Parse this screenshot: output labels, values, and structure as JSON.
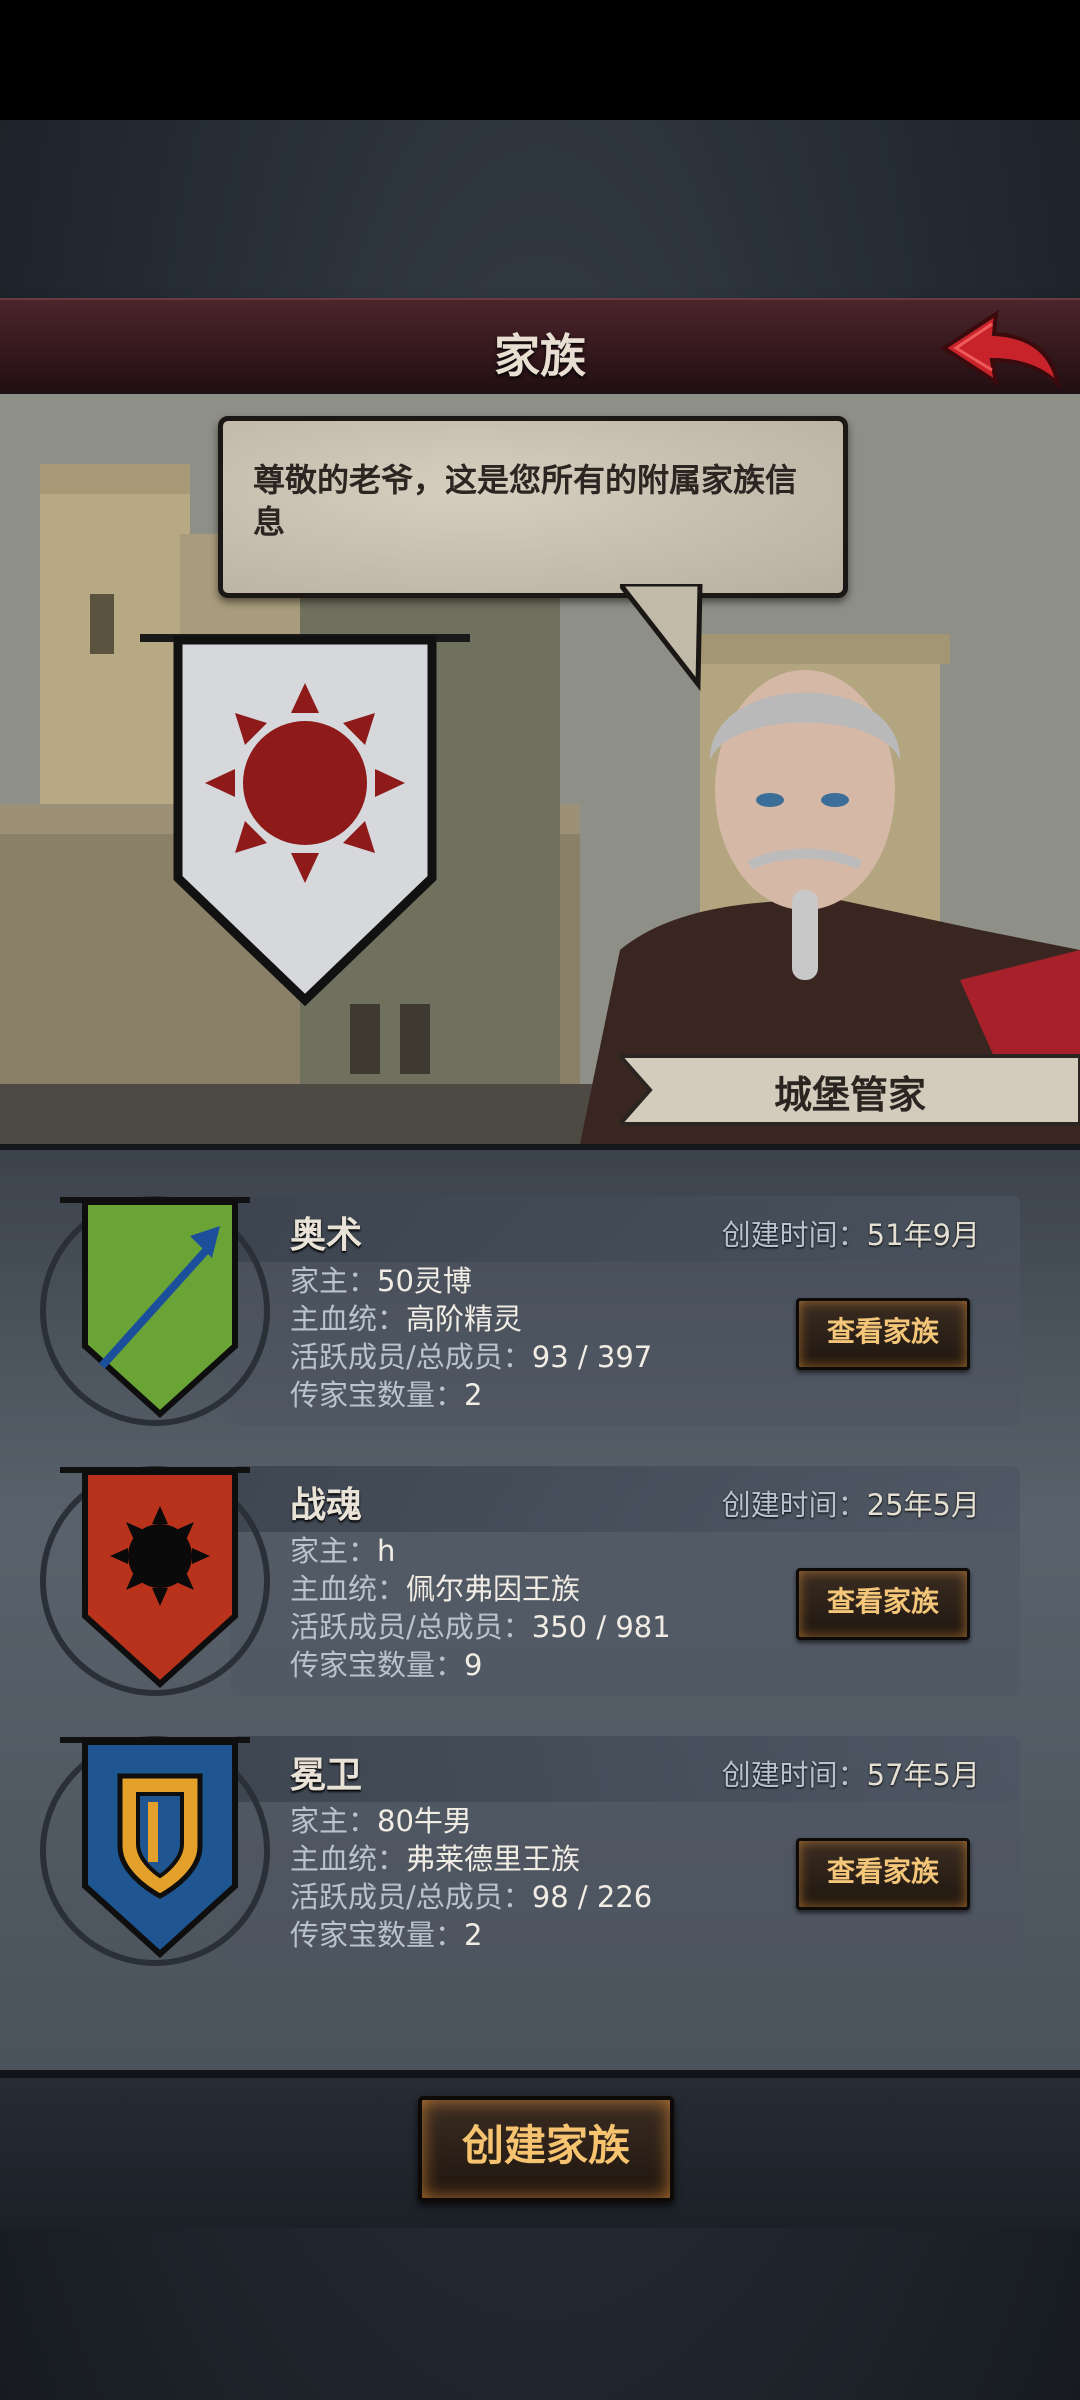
{
  "header": {
    "title": "家族"
  },
  "npc": {
    "dialog": "尊敬的老爷，这是您所有的附属家族信息",
    "name": "城堡管家"
  },
  "labels": {
    "created": "创建时间：",
    "head": "家主：",
    "bloodline": "主血统：",
    "members": "活跃成员/总成员：",
    "heirlooms": "传家宝数量："
  },
  "families": [
    {
      "name": "奥术",
      "created": "51年9月",
      "head": "50灵博",
      "bloodline": "高阶精灵",
      "members": "93 / 397",
      "heirlooms": "2",
      "button": "查看家族",
      "banner_color": "#6aa336",
      "emblem": "spear-icon"
    },
    {
      "name": "战魂",
      "created": "25年5月",
      "head": "h",
      "bloodline": "佩尔弗因王族",
      "members": "350 / 981",
      "heirlooms": "9",
      "button": "查看家族",
      "banner_color": "#b8321c",
      "emblem": "sun-icon"
    },
    {
      "name": "冕卫",
      "created": "57年5月",
      "head": "80牛男",
      "bloodline": "弗莱德里王族",
      "members": "98 / 226",
      "heirlooms": "2",
      "button": "查看家族",
      "banner_color": "#1f5590",
      "emblem": "shield-icon"
    }
  ],
  "footer": {
    "create_button": "创建家族"
  }
}
